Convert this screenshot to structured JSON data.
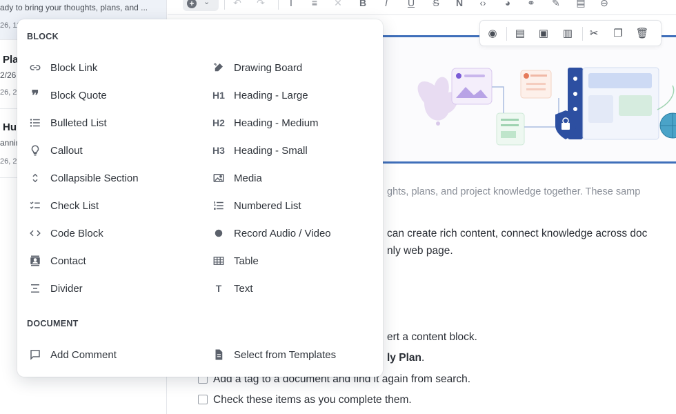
{
  "sidebar": {
    "docs": [
      {
        "title": "",
        "snippet": "ady to bring your thoughts, plans, and ...",
        "date": "26, 11"
      },
      {
        "title": "Pla",
        "snippet": "2/26",
        "date": "26, 2"
      },
      {
        "title": "Hu",
        "snippet": "annin",
        "date": "26, 2"
      }
    ]
  },
  "editor": {
    "intro_line": "ghts, plans, and project knowledge together. These samp",
    "para1_line1": "can create rich content, connect knowledge across doc",
    "para1_line2": "nly web page.",
    "step1": "ert a content block.",
    "step2": "ly Plan",
    "step2_suffix": ".",
    "check1": "Add a tag to a document and find it again from search.",
    "check2": "Check these items as you complete them."
  },
  "menu": {
    "block_title": "BLOCK",
    "document_title": "DOCUMENT",
    "left_items": [
      {
        "label": "Block Link",
        "icon": "link-icon"
      },
      {
        "label": "Block Quote",
        "icon": "quote-icon"
      },
      {
        "label": "Bulleted List",
        "icon": "bulleted-list-icon"
      },
      {
        "label": "Callout",
        "icon": "lightbulb-icon"
      },
      {
        "label": "Collapsible Section",
        "icon": "expand-collapse-icon"
      },
      {
        "label": "Check List",
        "icon": "check-list-icon"
      },
      {
        "label": "Code Block",
        "icon": "code-icon"
      },
      {
        "label": "Contact",
        "icon": "contact-card-icon"
      },
      {
        "label": "Divider",
        "icon": "divider-icon"
      }
    ],
    "right_items": [
      {
        "label": "Drawing Board",
        "icon": "draw-icon"
      },
      {
        "label": "Heading - Large",
        "icon": "h1-icon",
        "glyph": "H1"
      },
      {
        "label": "Heading - Medium",
        "icon": "h2-icon",
        "glyph": "H2"
      },
      {
        "label": "Heading - Small",
        "icon": "h3-icon",
        "glyph": "H3"
      },
      {
        "label": "Media",
        "icon": "image-icon"
      },
      {
        "label": "Numbered List",
        "icon": "numbered-list-icon"
      },
      {
        "label": "Record Audio / Video",
        "icon": "record-icon"
      },
      {
        "label": "Table",
        "icon": "table-icon"
      },
      {
        "label": "Text",
        "icon": "text-icon",
        "glyph": "T"
      }
    ],
    "doc_items": [
      {
        "label": "Add Comment",
        "icon": "comment-icon"
      },
      {
        "label": "Select from Templates",
        "icon": "template-icon"
      }
    ]
  },
  "colors": {
    "accent": "#3f6fba",
    "menu_bg": "#ffffff",
    "selected_doc_bg": "#eef2f8"
  }
}
